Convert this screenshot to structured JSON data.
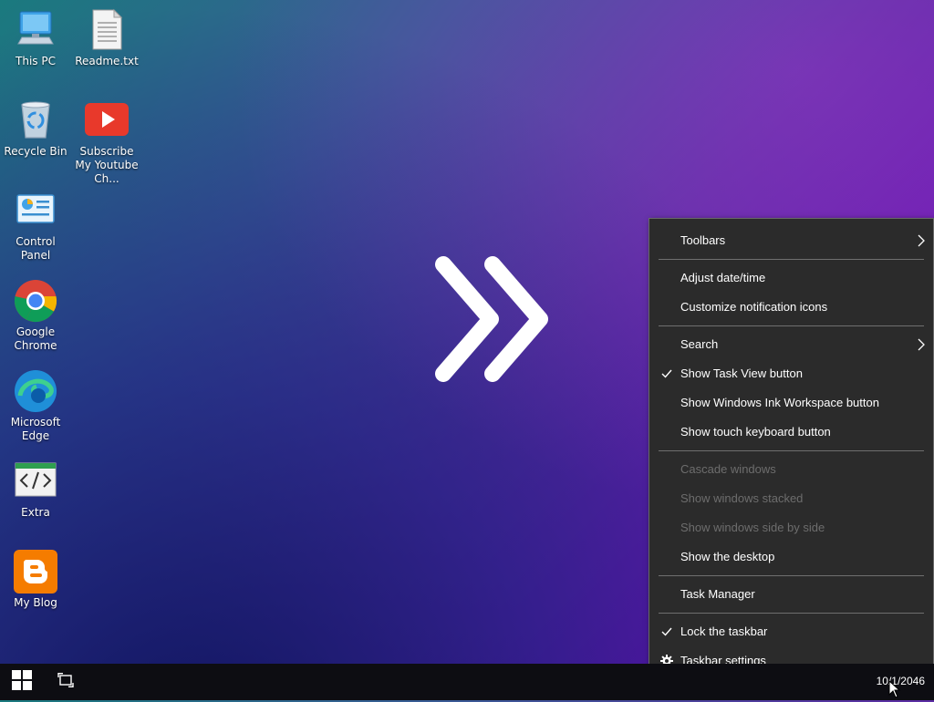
{
  "desktop": {
    "icons": [
      {
        "label": "This PC",
        "icon": "computer-icon"
      },
      {
        "label": "Readme.txt",
        "icon": "text-file-icon"
      },
      {
        "label": "Recycle Bin",
        "icon": "recycle-bin-icon"
      },
      {
        "label": "Subscribe My Youtube Ch...",
        "icon": "youtube-icon"
      },
      {
        "label": "Control Panel",
        "icon": "control-panel-icon"
      },
      {
        "label": "Google Chrome",
        "icon": "chrome-icon"
      },
      {
        "label": "Microsoft Edge",
        "icon": "edge-icon"
      },
      {
        "label": "Extra",
        "icon": "code-icon"
      },
      {
        "label": "My Blog",
        "icon": "blogger-icon"
      }
    ],
    "center_logo": "double-chevron-right-icon"
  },
  "context_menu": {
    "items": [
      {
        "label": "Toolbars",
        "submenu": true
      },
      {
        "label": "Adjust date/time"
      },
      {
        "label": "Customize notification icons"
      },
      {
        "label": "Search",
        "submenu": true
      },
      {
        "label": "Show Task View button",
        "checked": true
      },
      {
        "label": "Show Windows Ink Workspace button"
      },
      {
        "label": "Show touch keyboard button"
      },
      {
        "label": "Cascade windows",
        "disabled": true
      },
      {
        "label": "Show windows stacked",
        "disabled": true
      },
      {
        "label": "Show windows side by side",
        "disabled": true
      },
      {
        "label": "Show the desktop"
      },
      {
        "label": "Task Manager"
      },
      {
        "label": "Lock the taskbar",
        "checked": true
      },
      {
        "label": "Taskbar settings",
        "icon": "gear-icon"
      }
    ]
  },
  "taskbar": {
    "start_icon": "windows-logo-icon",
    "task_view_icon": "task-view-icon",
    "clock": "10/1/2046"
  },
  "colors": {
    "menu_bg": "#2b2b2b",
    "menu_border": "#6a6a6a",
    "menu_disabled": "#6d6d6d",
    "taskbar_bg": "#0d0d12"
  }
}
